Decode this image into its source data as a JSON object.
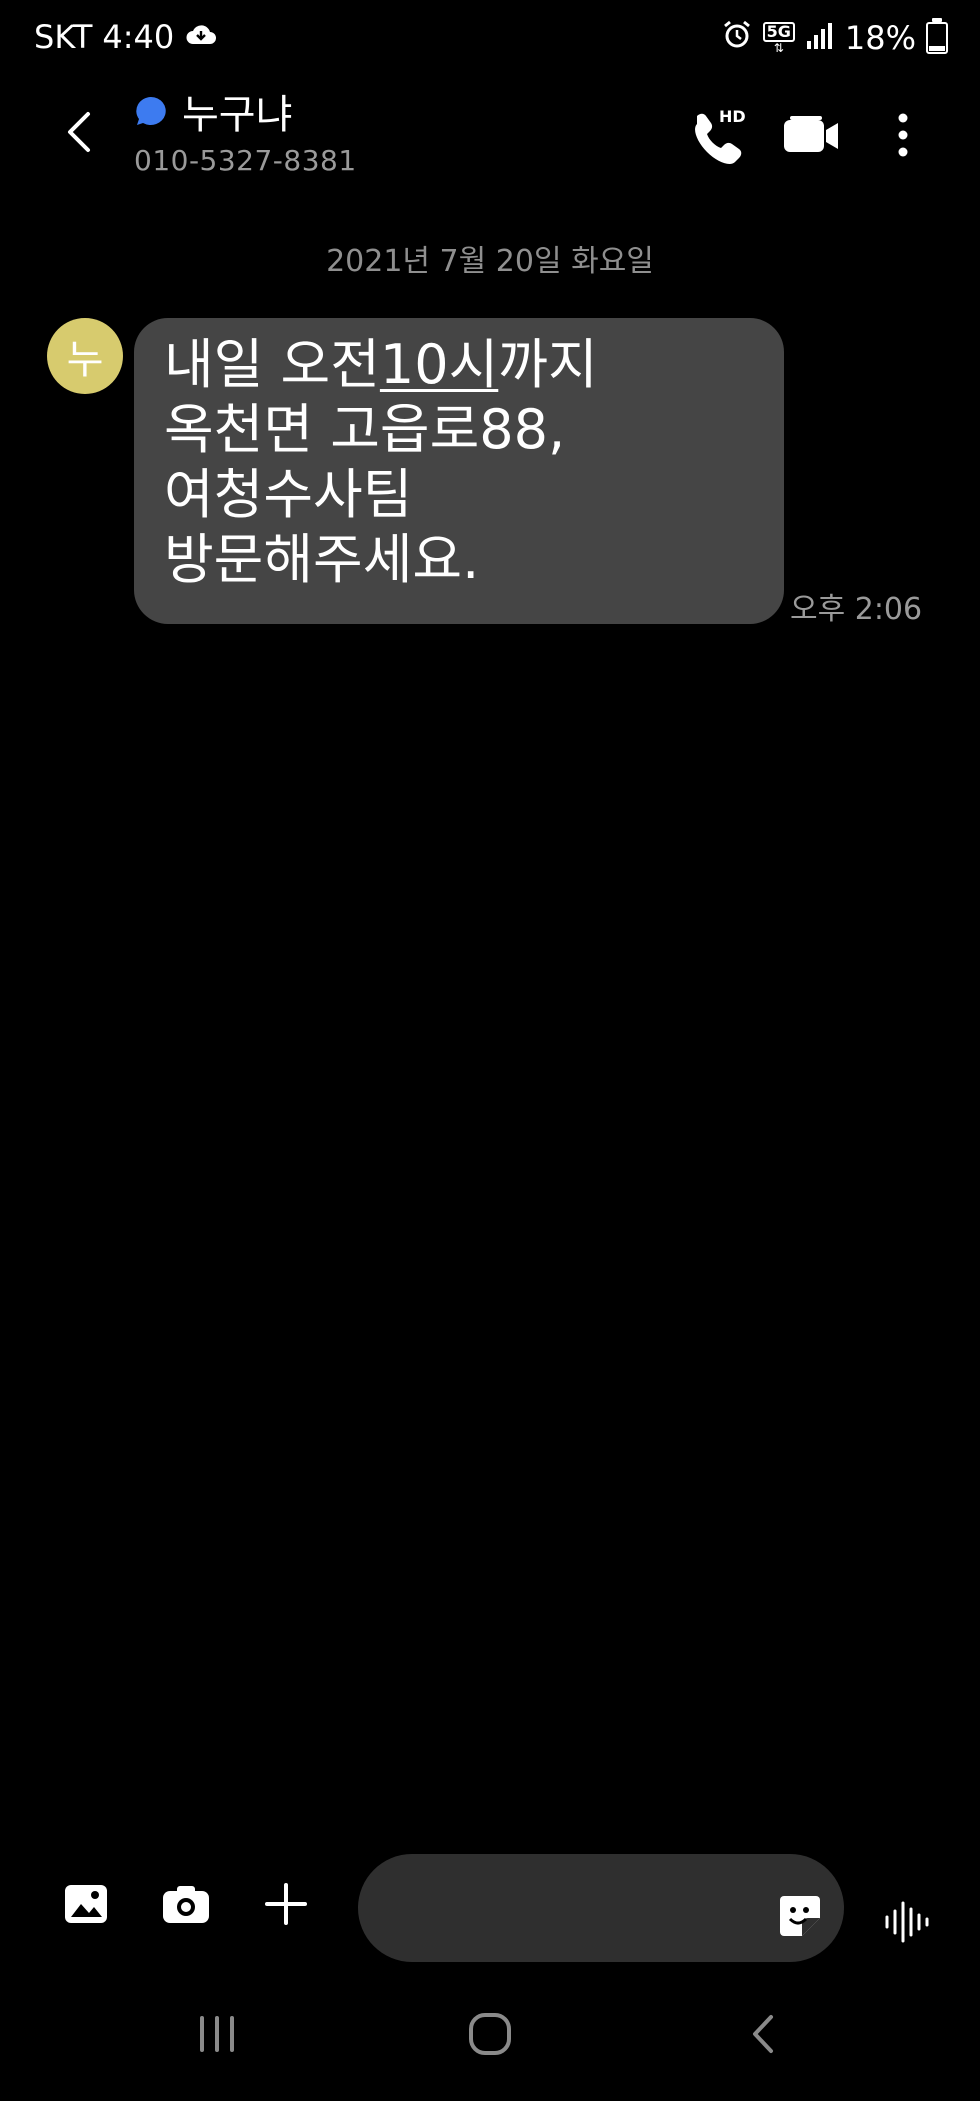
{
  "status_bar": {
    "carrier": "SKT",
    "time": "4:40",
    "network": "5G",
    "battery": "18%",
    "battery_level": 0.18
  },
  "header": {
    "contact_name": "누구냐",
    "contact_number": "010-5327-8381",
    "call_badge": "HD",
    "accent_color": "#3d7bf0"
  },
  "conversation": {
    "date_separator": "2021년 7월 20일 화요일",
    "messages": [
      {
        "avatar_initial": "누",
        "avatar_color": "#d7cb6e",
        "line1_a": "내일 오전",
        "line1_link": "10시",
        "line1_b": "까지",
        "line2": "옥천면 고읍로88,",
        "line3": "여청수사팀",
        "line4": "방문해주세요.",
        "time": "오후 2:06"
      }
    ]
  },
  "compose": {
    "input_value": "",
    "input_placeholder": ""
  },
  "icons": {
    "back": "chevron-left-icon",
    "call": "phone-hd-icon",
    "video": "video-camera-icon",
    "more": "more-vertical-icon",
    "gallery": "image-icon",
    "camera": "camera-icon",
    "add": "plus-icon",
    "sticker": "sticker-icon",
    "voice": "voice-wave-icon"
  }
}
